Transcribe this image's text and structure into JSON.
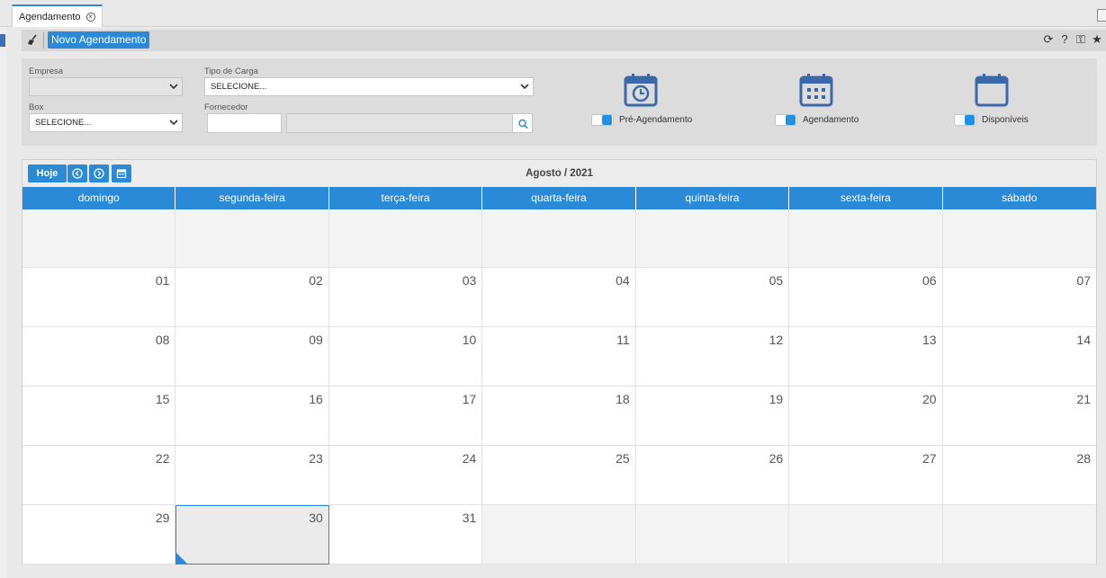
{
  "tab": {
    "label": "Agendamento"
  },
  "toolbar": {
    "new_label": "Novo Agendamento",
    "right_icons": [
      "refresh-icon",
      "help-icon",
      "lock-icon",
      "star-icon"
    ]
  },
  "filters": {
    "empresa": {
      "label": "Empresa",
      "value": ""
    },
    "tipo_carga": {
      "label": "Tipo de Carga",
      "value": "SELECIONE..."
    },
    "box": {
      "label": "Box",
      "value": "SELECIONE..."
    },
    "fornecedor": {
      "label": "Fornecedor",
      "code": "",
      "name": ""
    }
  },
  "legend": [
    {
      "label": "Pré-Agendamento",
      "icon": "calendar-clock-icon",
      "on": true
    },
    {
      "label": "Agendamento",
      "icon": "calendar-grid-icon",
      "on": true
    },
    {
      "label": "Disponíveis",
      "icon": "calendar-empty-icon",
      "on": true
    }
  ],
  "calendar": {
    "today_label": "Hoje",
    "title": "Agosto / 2021",
    "weekdays": [
      "domingo",
      "segunda-feira",
      "terça-feira",
      "quarta-feira",
      "quinta-feira",
      "sexta-feira",
      "sábado"
    ],
    "weeks": [
      [
        "",
        "",
        "",
        "",
        "",
        "",
        ""
      ],
      [
        "01",
        "02",
        "03",
        "04",
        "05",
        "06",
        "07"
      ],
      [
        "08",
        "09",
        "10",
        "11",
        "12",
        "13",
        "14"
      ],
      [
        "15",
        "16",
        "17",
        "18",
        "19",
        "20",
        "21"
      ],
      [
        "22",
        "23",
        "24",
        "25",
        "26",
        "27",
        "28"
      ],
      [
        "29",
        "30",
        "31",
        "",
        "",
        "",
        ""
      ]
    ],
    "selected_day": "30"
  },
  "colors": {
    "accent": "#2a8ad8",
    "toggle": "#1e90e6"
  }
}
